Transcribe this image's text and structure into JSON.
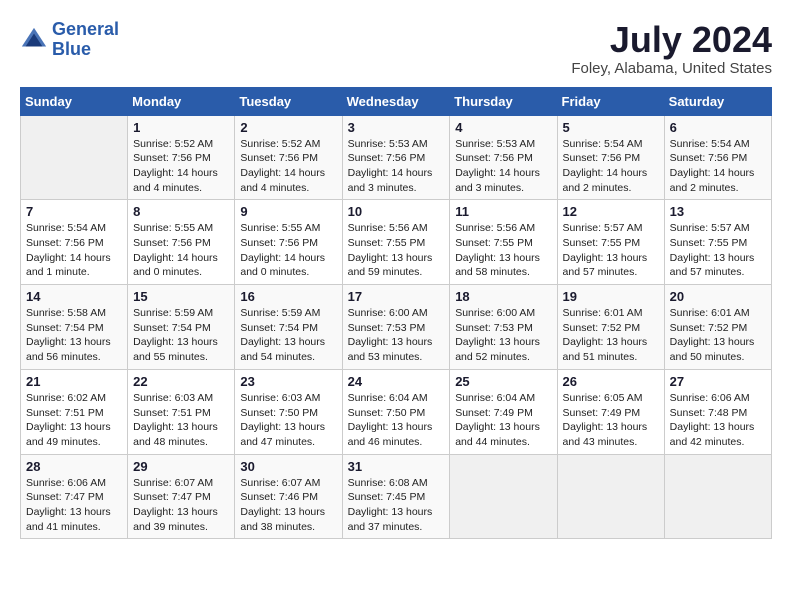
{
  "header": {
    "logo_line1": "General",
    "logo_line2": "Blue",
    "month_year": "July 2024",
    "location": "Foley, Alabama, United States"
  },
  "weekdays": [
    "Sunday",
    "Monday",
    "Tuesday",
    "Wednesday",
    "Thursday",
    "Friday",
    "Saturday"
  ],
  "weeks": [
    [
      {
        "day": "",
        "sunrise": "",
        "sunset": "",
        "daylight": ""
      },
      {
        "day": "1",
        "sunrise": "Sunrise: 5:52 AM",
        "sunset": "Sunset: 7:56 PM",
        "daylight": "Daylight: 14 hours and 4 minutes."
      },
      {
        "day": "2",
        "sunrise": "Sunrise: 5:52 AM",
        "sunset": "Sunset: 7:56 PM",
        "daylight": "Daylight: 14 hours and 4 minutes."
      },
      {
        "day": "3",
        "sunrise": "Sunrise: 5:53 AM",
        "sunset": "Sunset: 7:56 PM",
        "daylight": "Daylight: 14 hours and 3 minutes."
      },
      {
        "day": "4",
        "sunrise": "Sunrise: 5:53 AM",
        "sunset": "Sunset: 7:56 PM",
        "daylight": "Daylight: 14 hours and 3 minutes."
      },
      {
        "day": "5",
        "sunrise": "Sunrise: 5:54 AM",
        "sunset": "Sunset: 7:56 PM",
        "daylight": "Daylight: 14 hours and 2 minutes."
      },
      {
        "day": "6",
        "sunrise": "Sunrise: 5:54 AM",
        "sunset": "Sunset: 7:56 PM",
        "daylight": "Daylight: 14 hours and 2 minutes."
      }
    ],
    [
      {
        "day": "7",
        "sunrise": "Sunrise: 5:54 AM",
        "sunset": "Sunset: 7:56 PM",
        "daylight": "Daylight: 14 hours and 1 minute."
      },
      {
        "day": "8",
        "sunrise": "Sunrise: 5:55 AM",
        "sunset": "Sunset: 7:56 PM",
        "daylight": "Daylight: 14 hours and 0 minutes."
      },
      {
        "day": "9",
        "sunrise": "Sunrise: 5:55 AM",
        "sunset": "Sunset: 7:56 PM",
        "daylight": "Daylight: 14 hours and 0 minutes."
      },
      {
        "day": "10",
        "sunrise": "Sunrise: 5:56 AM",
        "sunset": "Sunset: 7:55 PM",
        "daylight": "Daylight: 13 hours and 59 minutes."
      },
      {
        "day": "11",
        "sunrise": "Sunrise: 5:56 AM",
        "sunset": "Sunset: 7:55 PM",
        "daylight": "Daylight: 13 hours and 58 minutes."
      },
      {
        "day": "12",
        "sunrise": "Sunrise: 5:57 AM",
        "sunset": "Sunset: 7:55 PM",
        "daylight": "Daylight: 13 hours and 57 minutes."
      },
      {
        "day": "13",
        "sunrise": "Sunrise: 5:57 AM",
        "sunset": "Sunset: 7:55 PM",
        "daylight": "Daylight: 13 hours and 57 minutes."
      }
    ],
    [
      {
        "day": "14",
        "sunrise": "Sunrise: 5:58 AM",
        "sunset": "Sunset: 7:54 PM",
        "daylight": "Daylight: 13 hours and 56 minutes."
      },
      {
        "day": "15",
        "sunrise": "Sunrise: 5:59 AM",
        "sunset": "Sunset: 7:54 PM",
        "daylight": "Daylight: 13 hours and 55 minutes."
      },
      {
        "day": "16",
        "sunrise": "Sunrise: 5:59 AM",
        "sunset": "Sunset: 7:54 PM",
        "daylight": "Daylight: 13 hours and 54 minutes."
      },
      {
        "day": "17",
        "sunrise": "Sunrise: 6:00 AM",
        "sunset": "Sunset: 7:53 PM",
        "daylight": "Daylight: 13 hours and 53 minutes."
      },
      {
        "day": "18",
        "sunrise": "Sunrise: 6:00 AM",
        "sunset": "Sunset: 7:53 PM",
        "daylight": "Daylight: 13 hours and 52 minutes."
      },
      {
        "day": "19",
        "sunrise": "Sunrise: 6:01 AM",
        "sunset": "Sunset: 7:52 PM",
        "daylight": "Daylight: 13 hours and 51 minutes."
      },
      {
        "day": "20",
        "sunrise": "Sunrise: 6:01 AM",
        "sunset": "Sunset: 7:52 PM",
        "daylight": "Daylight: 13 hours and 50 minutes."
      }
    ],
    [
      {
        "day": "21",
        "sunrise": "Sunrise: 6:02 AM",
        "sunset": "Sunset: 7:51 PM",
        "daylight": "Daylight: 13 hours and 49 minutes."
      },
      {
        "day": "22",
        "sunrise": "Sunrise: 6:03 AM",
        "sunset": "Sunset: 7:51 PM",
        "daylight": "Daylight: 13 hours and 48 minutes."
      },
      {
        "day": "23",
        "sunrise": "Sunrise: 6:03 AM",
        "sunset": "Sunset: 7:50 PM",
        "daylight": "Daylight: 13 hours and 47 minutes."
      },
      {
        "day": "24",
        "sunrise": "Sunrise: 6:04 AM",
        "sunset": "Sunset: 7:50 PM",
        "daylight": "Daylight: 13 hours and 46 minutes."
      },
      {
        "day": "25",
        "sunrise": "Sunrise: 6:04 AM",
        "sunset": "Sunset: 7:49 PM",
        "daylight": "Daylight: 13 hours and 44 minutes."
      },
      {
        "day": "26",
        "sunrise": "Sunrise: 6:05 AM",
        "sunset": "Sunset: 7:49 PM",
        "daylight": "Daylight: 13 hours and 43 minutes."
      },
      {
        "day": "27",
        "sunrise": "Sunrise: 6:06 AM",
        "sunset": "Sunset: 7:48 PM",
        "daylight": "Daylight: 13 hours and 42 minutes."
      }
    ],
    [
      {
        "day": "28",
        "sunrise": "Sunrise: 6:06 AM",
        "sunset": "Sunset: 7:47 PM",
        "daylight": "Daylight: 13 hours and 41 minutes."
      },
      {
        "day": "29",
        "sunrise": "Sunrise: 6:07 AM",
        "sunset": "Sunset: 7:47 PM",
        "daylight": "Daylight: 13 hours and 39 minutes."
      },
      {
        "day": "30",
        "sunrise": "Sunrise: 6:07 AM",
        "sunset": "Sunset: 7:46 PM",
        "daylight": "Daylight: 13 hours and 38 minutes."
      },
      {
        "day": "31",
        "sunrise": "Sunrise: 6:08 AM",
        "sunset": "Sunset: 7:45 PM",
        "daylight": "Daylight: 13 hours and 37 minutes."
      },
      {
        "day": "",
        "sunrise": "",
        "sunset": "",
        "daylight": ""
      },
      {
        "day": "",
        "sunrise": "",
        "sunset": "",
        "daylight": ""
      },
      {
        "day": "",
        "sunrise": "",
        "sunset": "",
        "daylight": ""
      }
    ]
  ]
}
